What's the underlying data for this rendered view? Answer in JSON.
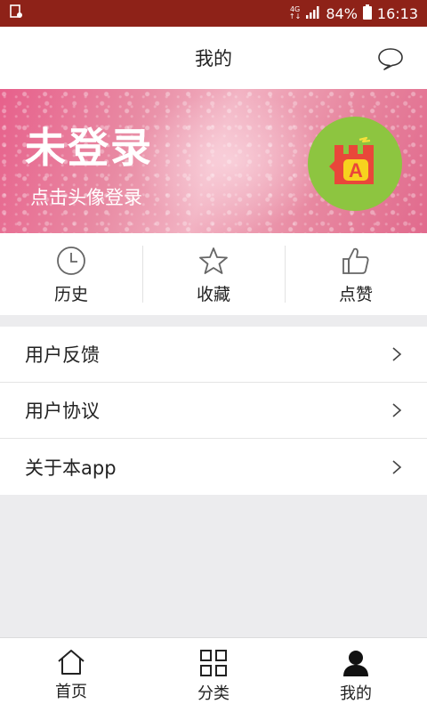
{
  "status_bar": {
    "network": "4G",
    "network_sub": "↑↓",
    "battery": "84%",
    "time": "16:13",
    "color": "#8e2218"
  },
  "header": {
    "title": "我的"
  },
  "banner": {
    "title": "未登录",
    "subtitle": "点击头像登录",
    "avatar_icon": "app-logo-icon",
    "avatar_color": "#8dc540"
  },
  "quick_actions": [
    {
      "label": "历史",
      "icon": "clock-icon"
    },
    {
      "label": "收藏",
      "icon": "star-icon"
    },
    {
      "label": "点赞",
      "icon": "thumbs-up-icon"
    }
  ],
  "menu": [
    {
      "label": "用户反馈"
    },
    {
      "label": "用户协议"
    },
    {
      "label": "关于本app"
    }
  ],
  "tabs": [
    {
      "label": "首页",
      "icon": "home-icon",
      "active": false
    },
    {
      "label": "分类",
      "icon": "grid-icon",
      "active": false
    },
    {
      "label": "我的",
      "icon": "person-icon",
      "active": true
    }
  ]
}
